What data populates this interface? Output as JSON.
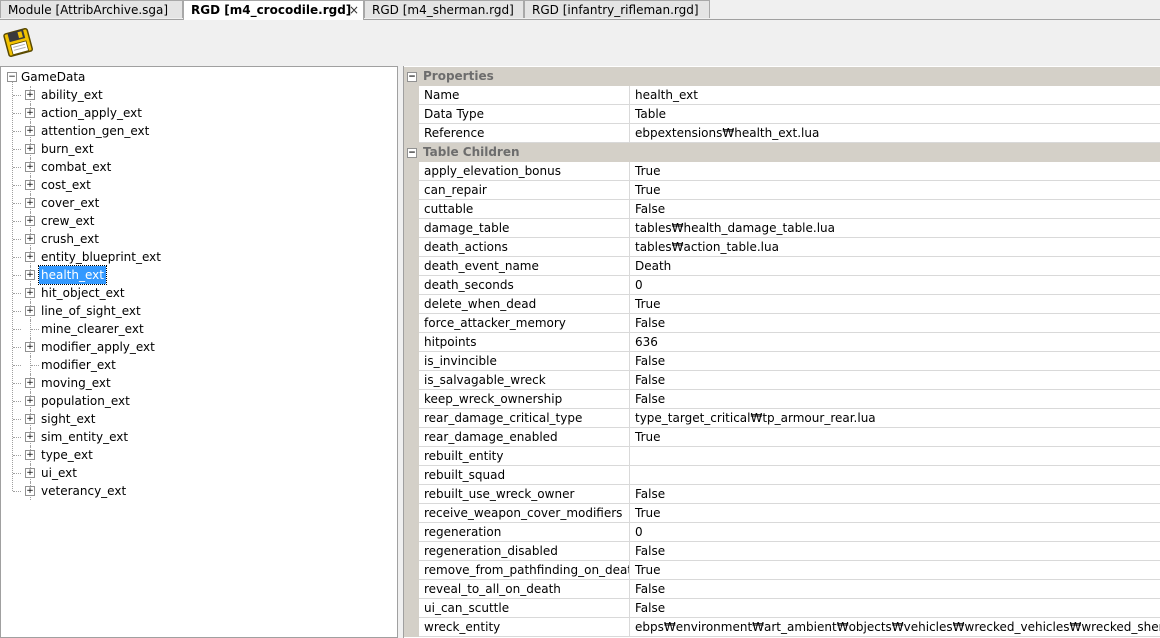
{
  "tabs": [
    {
      "label": "Module [AttribArchive.sga]",
      "active": false
    },
    {
      "label": "RGD [m4_crocodile.rgd]",
      "active": true,
      "close": "×"
    },
    {
      "label": "RGD [m4_sherman.rgd]",
      "active": false
    },
    {
      "label": "RGD [infantry_rifleman.rgd]",
      "active": false
    }
  ],
  "toolbar": {
    "save_icon": "floppy-disk-icon"
  },
  "tree": {
    "root": "GameData",
    "items": [
      {
        "label": "ability_ext",
        "expandable": true
      },
      {
        "label": "action_apply_ext",
        "expandable": true
      },
      {
        "label": "attention_gen_ext",
        "expandable": true
      },
      {
        "label": "burn_ext",
        "expandable": true
      },
      {
        "label": "combat_ext",
        "expandable": true
      },
      {
        "label": "cost_ext",
        "expandable": true
      },
      {
        "label": "cover_ext",
        "expandable": true
      },
      {
        "label": "crew_ext",
        "expandable": true
      },
      {
        "label": "crush_ext",
        "expandable": true
      },
      {
        "label": "entity_blueprint_ext",
        "expandable": true
      },
      {
        "label": "health_ext",
        "expandable": true,
        "selected": true
      },
      {
        "label": "hit_object_ext",
        "expandable": true
      },
      {
        "label": "line_of_sight_ext",
        "expandable": true
      },
      {
        "label": "mine_clearer_ext",
        "expandable": false
      },
      {
        "label": "modifier_apply_ext",
        "expandable": true
      },
      {
        "label": "modifier_ext",
        "expandable": false
      },
      {
        "label": "moving_ext",
        "expandable": true
      },
      {
        "label": "population_ext",
        "expandable": true
      },
      {
        "label": "sight_ext",
        "expandable": true
      },
      {
        "label": "sim_entity_ext",
        "expandable": true
      },
      {
        "label": "type_ext",
        "expandable": true
      },
      {
        "label": "ui_ext",
        "expandable": true
      },
      {
        "label": "veterancy_ext",
        "expandable": true
      }
    ]
  },
  "grid": {
    "categories": [
      {
        "label": "Properties",
        "rows": [
          {
            "name": "Name",
            "value": "health_ext"
          },
          {
            "name": "Data Type",
            "value": "Table"
          },
          {
            "name": "Reference",
            "value": "ebpextensions₩health_ext.lua"
          }
        ]
      },
      {
        "label": "Table Children",
        "rows": [
          {
            "name": "apply_elevation_bonus",
            "value": "True"
          },
          {
            "name": "can_repair",
            "value": "True"
          },
          {
            "name": "cuttable",
            "value": "False"
          },
          {
            "name": "damage_table",
            "value": "tables₩health_damage_table.lua"
          },
          {
            "name": "death_actions",
            "value": "tables₩action_table.lua"
          },
          {
            "name": "death_event_name",
            "value": "Death"
          },
          {
            "name": "death_seconds",
            "value": "0"
          },
          {
            "name": "delete_when_dead",
            "value": "True"
          },
          {
            "name": "force_attacker_memory",
            "value": "False"
          },
          {
            "name": "hitpoints",
            "value": "636"
          },
          {
            "name": "is_invincible",
            "value": "False"
          },
          {
            "name": "is_salvagable_wreck",
            "value": "False"
          },
          {
            "name": "keep_wreck_ownership",
            "value": "False"
          },
          {
            "name": "rear_damage_critical_type",
            "value": "type_target_critical₩tp_armour_rear.lua"
          },
          {
            "name": "rear_damage_enabled",
            "value": "True"
          },
          {
            "name": "rebuilt_entity",
            "value": ""
          },
          {
            "name": "rebuilt_squad",
            "value": ""
          },
          {
            "name": "rebuilt_use_wreck_owner",
            "value": "False"
          },
          {
            "name": "receive_weapon_cover_modifiers",
            "value": "True"
          },
          {
            "name": "regeneration",
            "value": "0"
          },
          {
            "name": "regeneration_disabled",
            "value": "False"
          },
          {
            "name": "remove_from_pathfinding_on_death",
            "value": "True"
          },
          {
            "name": "reveal_to_all_on_death",
            "value": "False"
          },
          {
            "name": "ui_can_scuttle",
            "value": "False"
          },
          {
            "name": "wreck_entity",
            "value": "ebps₩environment₩art_ambient₩objects₩vehicles₩wrecked_vehicles₩wrecked_sherman.lua"
          }
        ]
      }
    ]
  }
}
